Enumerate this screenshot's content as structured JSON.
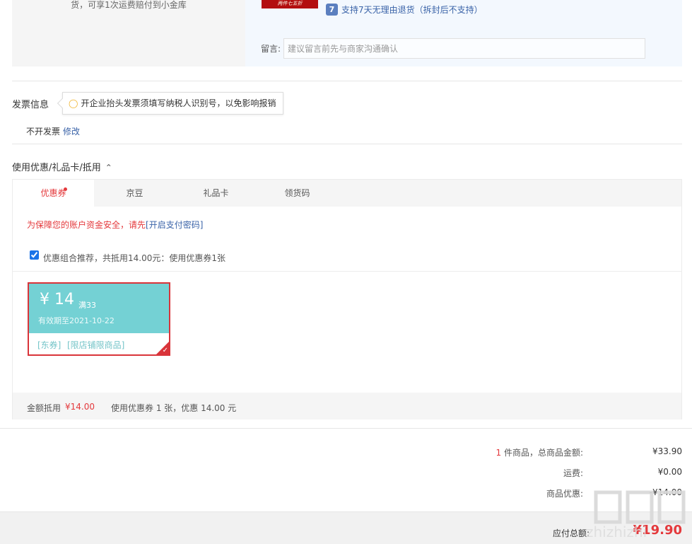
{
  "order": {
    "shipping_note": "货，可享1次运费赔付到小金库",
    "promo_banner": "两件七五折",
    "return_icon_label": "7",
    "return_policy": "支持7天无理由退货（拆封后不支持）",
    "message_label": "留言:",
    "message_placeholder": "建议留言前先与商家沟通确认"
  },
  "invoice": {
    "title": "发票信息",
    "tip": "开企业抬头发票须填写纳税人识别号，以免影响报销",
    "status": "不开发票",
    "edit_label": "修改"
  },
  "coupons": {
    "section_title": "使用优惠/礼品卡/抵用",
    "tabs": [
      {
        "label": "优惠券",
        "active": true,
        "dot": true
      },
      {
        "label": "京豆",
        "active": false
      },
      {
        "label": "礼品卡",
        "active": false
      },
      {
        "label": "领货码",
        "active": false
      }
    ],
    "security_text": "为保障您的账户资金安全，请先",
    "security_link": "[开启支付密码]",
    "combo_text": "优惠组合推荐，共抵用14.00元：使用优惠券1张",
    "combo_checked": true,
    "card": {
      "amount": "¥ 14",
      "condition": "满33",
      "expiry": "有效期至2021-10-22",
      "tag_type": "[东券]",
      "tag_scope": "[限店铺限商品]",
      "selected": true
    },
    "footer_label": "金额抵用",
    "footer_amount": "¥14.00",
    "footer_desc": "使用优惠券 1 张，优惠 14.00 元"
  },
  "summary": {
    "item_count": "1",
    "item_label": "件商品，总商品金额:",
    "item_total": "¥33.90",
    "shipping_label": "运费:",
    "shipping_value": "¥0.00",
    "discount_label": "商品优惠:",
    "discount_value": "-¥14.00",
    "payable_label": "应付总额:",
    "payable_value": "¥19.90"
  },
  "watermark": {
    "text": "zhizhizhi",
    "logo": "值值值"
  },
  "colors": {
    "accent_red": "#e4393c",
    "link_blue": "#3a63a8",
    "coupon_teal": "#74d1d4"
  }
}
